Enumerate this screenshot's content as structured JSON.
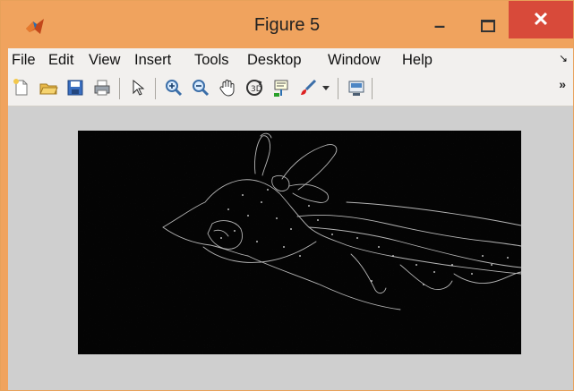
{
  "window": {
    "title": "Figure 5",
    "controls": {
      "minimize": "minimize",
      "maximize": "maximize",
      "close": "close"
    }
  },
  "menubar": {
    "items": [
      "File",
      "Edit",
      "View",
      "Insert",
      "Tools",
      "Desktop",
      "Window",
      "Help"
    ],
    "overflow_icon": "menu-overflow-icon"
  },
  "toolbar": {
    "tools": [
      "new-figure-icon",
      "open-file-icon",
      "save-icon",
      "print-icon",
      "edit-plot-arrow-icon",
      "zoom-in-icon",
      "zoom-out-icon",
      "pan-hand-icon",
      "rotate-3d-icon",
      "data-cursor-icon",
      "brush-icon",
      "brush-dropdown-icon",
      "link-plot-icon"
    ],
    "overflow_icon": "toolbar-overflow-icon"
  },
  "figure": {
    "image_description": "edge-detected grayscale giraffe head on black background"
  },
  "colors": {
    "title_bar": "#f0a35e",
    "close_button": "#d84a3a",
    "figure_background": "#cfcfcf",
    "image_background": "#040404"
  }
}
